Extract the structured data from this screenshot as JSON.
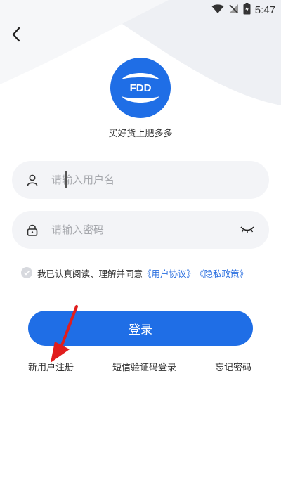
{
  "status": {
    "time": "5:47"
  },
  "app": {
    "logo_text": "FDD",
    "slogan": "买好货上肥多多"
  },
  "login_form": {
    "username_placeholder": "请输入用户名",
    "password_placeholder": "请输入密码"
  },
  "agreement": {
    "text": "我已认真阅读、理解并同意",
    "user_agreement": "《用户协议》",
    "privacy_policy": "《隐私政策》"
  },
  "login_button": "登录",
  "links": {
    "register": "新用户注册",
    "sms_login": "短信验证码登录",
    "forgot_password": "忘记密码"
  },
  "colors": {
    "primary": "#1f6ee6",
    "link": "#2a6fe0",
    "annotation": "#e11d1d"
  }
}
